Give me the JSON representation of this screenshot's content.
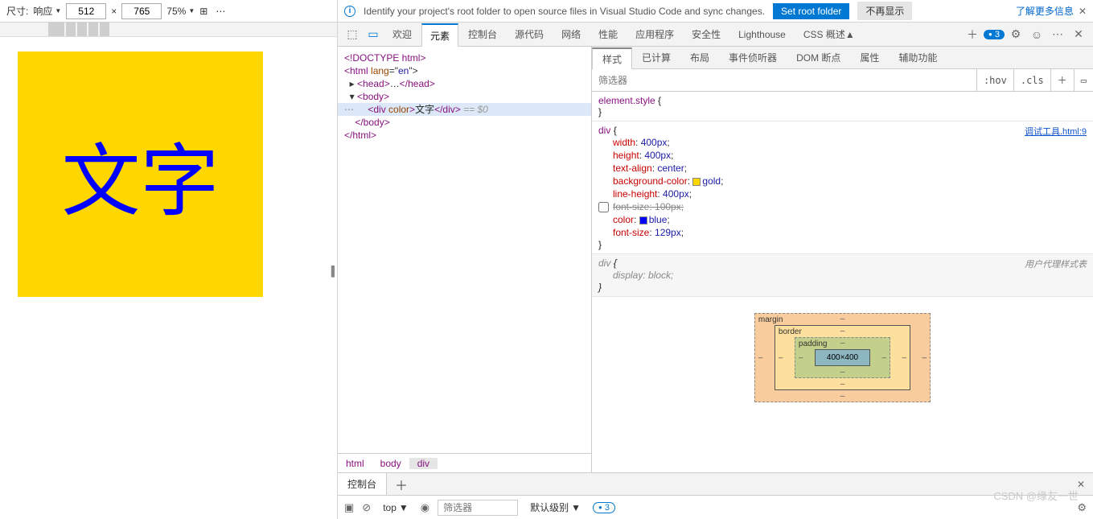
{
  "device": {
    "size_label": "尺寸:",
    "mode": "响应",
    "width": "512",
    "x": "×",
    "height": "765",
    "zoom": "75%",
    "rotate_icon": "⟳"
  },
  "notif": {
    "msg": "Identify your project's root folder to open source files in Visual Studio Code and sync changes.",
    "set_root": "Set root folder",
    "dismiss": "不再显示",
    "learn": "了解更多信息"
  },
  "tabs": {
    "welcome": "欢迎",
    "elements": "元素",
    "console": "控制台",
    "sources": "源代码",
    "network": "网络",
    "performance": "性能",
    "application": "应用程序",
    "security": "安全性",
    "lighthouse": "Lighthouse",
    "css_overview": "CSS 概述",
    "issues": "3"
  },
  "dom": {
    "l1": "<!DOCTYPE html>",
    "l2a": "<html",
    "l2b": " lang",
    "l2c": "=\"",
    "l2d": "en",
    "l2e": "\">",
    "l3a": "<head>",
    "l3b": "…",
    "l3c": "</head>",
    "l4": "<body>",
    "l5a": "<div",
    "l5b": " color",
    "l5c": ">",
    "l5d": "文字",
    "l5e": "</div>",
    "l5g": " == $0",
    "l6": "</body>",
    "l7": "</html>"
  },
  "crumbs": {
    "html": "html",
    "body": "body",
    "div": "div"
  },
  "styles_tabs": {
    "styles": "样式",
    "computed": "已计算",
    "layout": "布局",
    "listeners": "事件侦听器",
    "dom_bp": "DOM 断点",
    "props": "属性",
    "a11y": "辅助功能"
  },
  "filter": {
    "placeholder": "筛选器",
    "hov": ":hov",
    "cls": ".cls"
  },
  "rules": {
    "el_style_sel": "element.style",
    "src": "调试工具.html:9",
    "div_sel": "div",
    "width_n": "width",
    "width_v": "400px",
    "height_n": "height",
    "height_v": "400px",
    "ta_n": "text-align",
    "ta_v": "center",
    "bg_n": "background-color",
    "bg_v": "gold",
    "lh_n": "line-height",
    "lh_v": "400px",
    "fs1_n": "font-size",
    "fs1_v": "100px",
    "color_n": "color",
    "color_v": "blue",
    "fs2_n": "font-size",
    "fs2_v": "129px",
    "ua_label": "用户代理样式表",
    "disp_n": "display",
    "disp_v": "block"
  },
  "box": {
    "margin": "margin",
    "border": "border",
    "padding": "padding",
    "content": "400×400",
    "dash": "–"
  },
  "preview_text": "文字",
  "drawer": {
    "console_tab": "控制台",
    "context": "top",
    "filter_ph": "筛选器",
    "level": "默认级别",
    "issues": "3"
  },
  "watermark": "CSDN @缘友一世"
}
